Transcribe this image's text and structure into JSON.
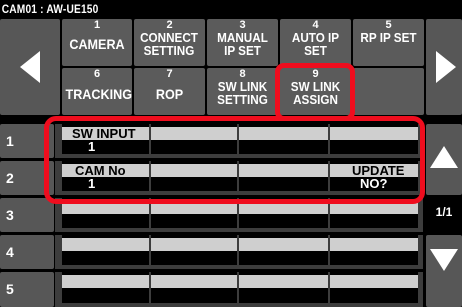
{
  "title": "CAM01 : AW-UE150",
  "menu": [
    {
      "num": "1",
      "label": "CAMERA"
    },
    {
      "num": "2",
      "label": "CONNECT SETTING"
    },
    {
      "num": "3",
      "label": "MANUAL IP SET"
    },
    {
      "num": "4",
      "label": "AUTO IP SET"
    },
    {
      "num": "5",
      "label": "RP IP SET"
    },
    {
      "num": "6",
      "label": "TRACKING"
    },
    {
      "num": "7",
      "label": "ROP"
    },
    {
      "num": "8",
      "label": "SW LINK SETTING"
    },
    {
      "num": "9",
      "label": "SW LINK ASSIGN"
    }
  ],
  "rows": [
    "1",
    "2",
    "3",
    "4",
    "5"
  ],
  "row1": {
    "header": "SW INPUT",
    "value": "1"
  },
  "row2": {
    "header": "CAM No",
    "value": "1",
    "update_header": "UPDATE",
    "update_value": "NO?"
  },
  "page_indicator": "1/1",
  "colors": {
    "highlight": "#ef0d1e",
    "button": "#5b5b5b"
  }
}
